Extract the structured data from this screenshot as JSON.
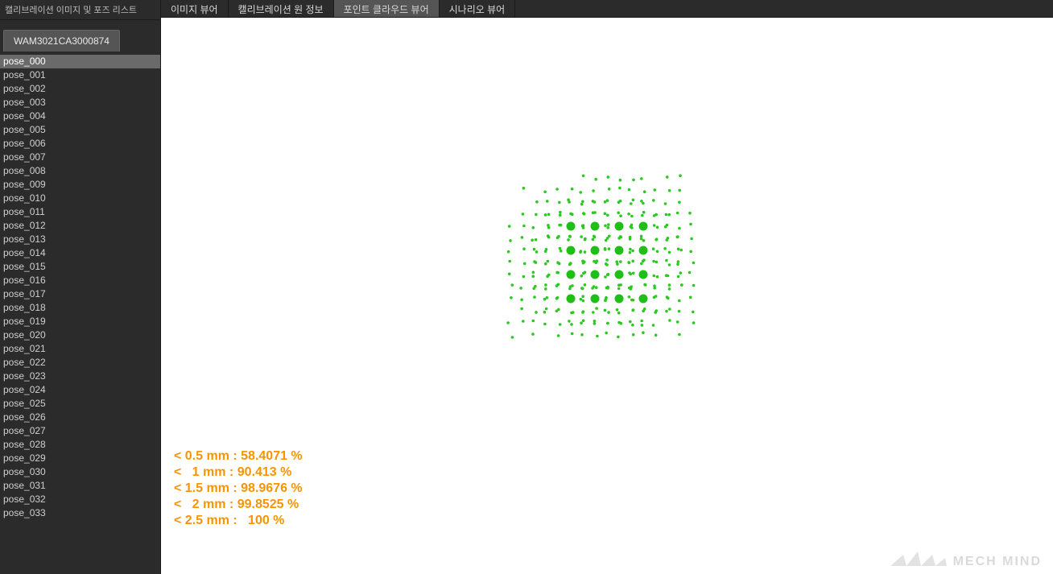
{
  "sidebar": {
    "title": "캘리브레이션 이미지 및 포즈 리스트",
    "tab_label": "WAM3021CA3000874",
    "selected_index": 0,
    "poses": [
      "pose_000",
      "pose_001",
      "pose_002",
      "pose_003",
      "pose_004",
      "pose_005",
      "pose_006",
      "pose_007",
      "pose_008",
      "pose_009",
      "pose_010",
      "pose_011",
      "pose_012",
      "pose_013",
      "pose_014",
      "pose_015",
      "pose_016",
      "pose_017",
      "pose_018",
      "pose_019",
      "pose_020",
      "pose_021",
      "pose_022",
      "pose_023",
      "pose_024",
      "pose_025",
      "pose_026",
      "pose_027",
      "pose_028",
      "pose_029",
      "pose_030",
      "pose_031",
      "pose_032",
      "pose_033"
    ]
  },
  "tabs": {
    "items": [
      {
        "label": "이미지 뷰어",
        "active": false
      },
      {
        "label": "캘리브레이션 원 정보",
        "active": false
      },
      {
        "label": "포인트 클라우드 뷰어",
        "active": true
      },
      {
        "label": "시나리오 뷰어",
        "active": false
      }
    ]
  },
  "pointcloud": {
    "grid_cols": 16,
    "grid_rows": 14,
    "cell": 15,
    "jitter": 3,
    "small_radius": 1.8,
    "big_radius": 5.5,
    "big_points_grid": [
      [
        5,
        4
      ],
      [
        7,
        4
      ],
      [
        9,
        4
      ],
      [
        11,
        4
      ],
      [
        5,
        6
      ],
      [
        7,
        6
      ],
      [
        9,
        6
      ],
      [
        11,
        6
      ],
      [
        5,
        8
      ],
      [
        7,
        8
      ],
      [
        9,
        8
      ],
      [
        11,
        8
      ],
      [
        5,
        10
      ],
      [
        7,
        10
      ],
      [
        9,
        10
      ],
      [
        11,
        10
      ]
    ]
  },
  "stats": {
    "lines": [
      "< 0.5 mm : 58.4071 %",
      "<   1 mm : 90.413 %",
      "< 1.5 mm : 98.9676 %",
      "<   2 mm : 99.8525 %",
      "< 2.5 mm :   100 %"
    ]
  },
  "logo": {
    "text": "MECH MIND"
  },
  "colors": {
    "point_green": "#29c91e",
    "stat_orange": "#f79400",
    "ui_dark": "#2b2b2b"
  }
}
